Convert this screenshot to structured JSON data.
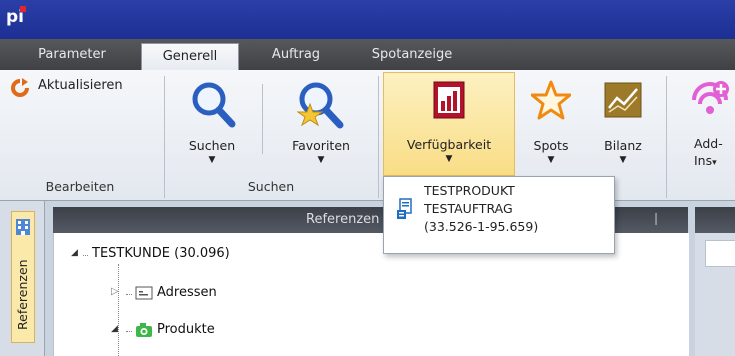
{
  "title_bar": {
    "logo_text": "pi"
  },
  "tabs": [
    "Parameter",
    "Generell",
    "Auftrag",
    "Spotanzeige"
  ],
  "ribbon": {
    "refresh_label": "Aktualisieren",
    "group_edit": "Bearbeiten",
    "search_label": "Suchen",
    "favorites_label": "Favoriten",
    "group_search": "Suchen",
    "availability_label": "Verfügbarkeit",
    "spots_label": "Spots",
    "balance_label": "Bilanz",
    "addins_line1": "Add-",
    "addins_line2": "Ins"
  },
  "popup": {
    "line1": "TESTPRODUKT",
    "line2": "TESTAUFTRAG",
    "line3": "(33.526-1-95.659)"
  },
  "sidebar": {
    "tab_label": "Referenzen"
  },
  "panel": {
    "title": "Referenzen",
    "pin_glyph": "❘"
  },
  "tree": {
    "root": "TESTKUNDE (30.096)",
    "child1": "Adressen",
    "child2": "Produkte"
  },
  "colors": {
    "accent_blue": "#1d2f93",
    "highlight": "#f9dd86",
    "popup_icon": "#1e6fc0"
  }
}
